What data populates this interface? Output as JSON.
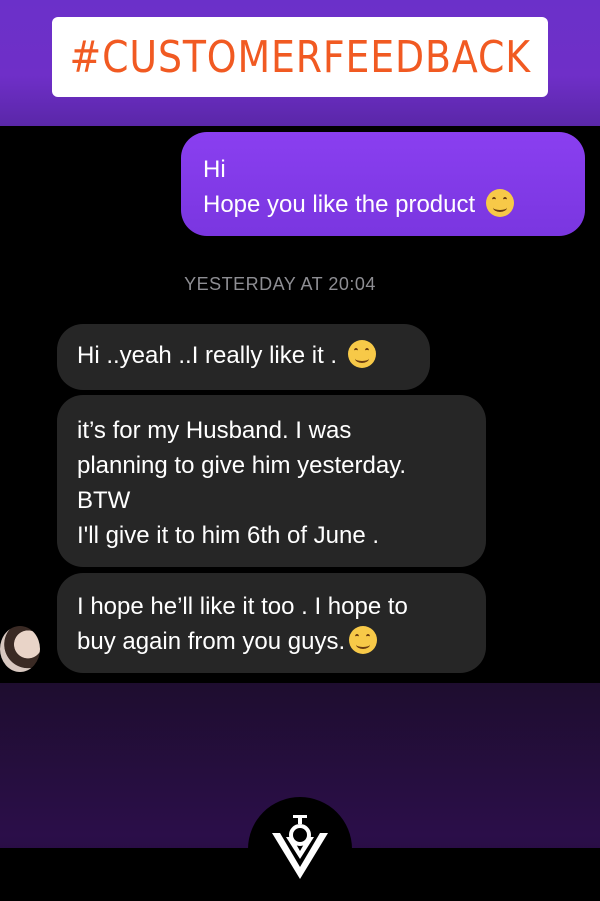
{
  "header": {
    "hashtag": "#CUSTOMERFEEDBACK"
  },
  "messages": {
    "sent": {
      "line1": "Hi",
      "line2": "Hope you like the product"
    },
    "timestamp": "YESTERDAY AT 20:04",
    "received": [
      {
        "lines": [
          "Hi ..yeah ..I really like it ."
        ]
      },
      {
        "lines": [
          "it’s for my Husband. I was",
          "planning to give him yesterday.",
          "BTW",
          "I'll give it to him 6th of June ."
        ]
      },
      {
        "lines": [
          "I hope he’ll like it too . I hope to",
          "buy again from you guys."
        ]
      }
    ]
  },
  "icons": {
    "emoji": "smiling-face-emoji",
    "avatar": "user-avatar",
    "logo": "brand-logo"
  },
  "colors": {
    "accent_purple": "#7a36e0",
    "hashtag_orange": "#f15a22",
    "bubble_dark": "#262626"
  }
}
